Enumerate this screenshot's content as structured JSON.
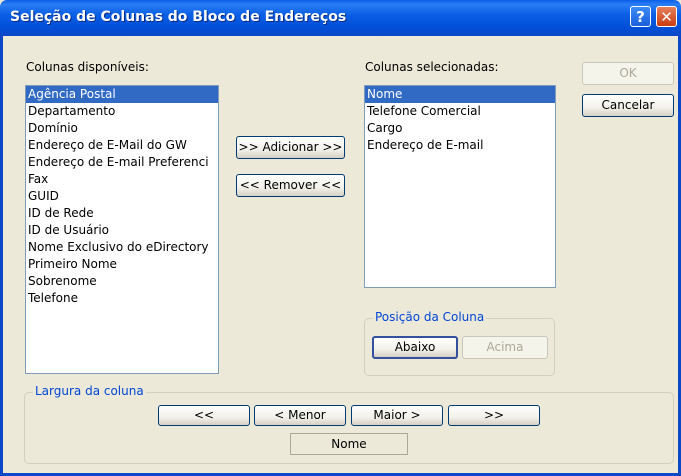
{
  "window": {
    "title": "Seleção de Colunas do Bloco de Endereços",
    "help_glyph": "?",
    "close_glyph": "✕"
  },
  "available": {
    "label": "Colunas disponíveis:",
    "items": [
      "Agência Postal",
      "Departamento",
      "Domínio",
      "Endereço de E-Mail do GW",
      "Endereço de E-mail Preferenci",
      "Fax",
      "GUID",
      "ID de Rede",
      "ID de Usuário",
      "Nome Exclusivo do eDirectory",
      "Primeiro Nome",
      "Sobrenome",
      "Telefone"
    ]
  },
  "selected": {
    "label": "Colunas selecionadas:",
    "items": [
      "Nome",
      "Telefone Comercial",
      "Cargo",
      "Endereço de E-mail"
    ]
  },
  "buttons": {
    "ok": "OK",
    "cancel": "Cancelar",
    "add": ">> Adicionar >>",
    "remove": "<< Remover <<"
  },
  "position_group": {
    "legend": "Posição da Coluna",
    "down": "Abaixo",
    "up": "Acima"
  },
  "width_group": {
    "legend": "Largura da coluna",
    "min": "<<",
    "smaller": "< Menor",
    "bigger": "Maior >",
    "max": ">>",
    "current_column": "Nome"
  }
}
